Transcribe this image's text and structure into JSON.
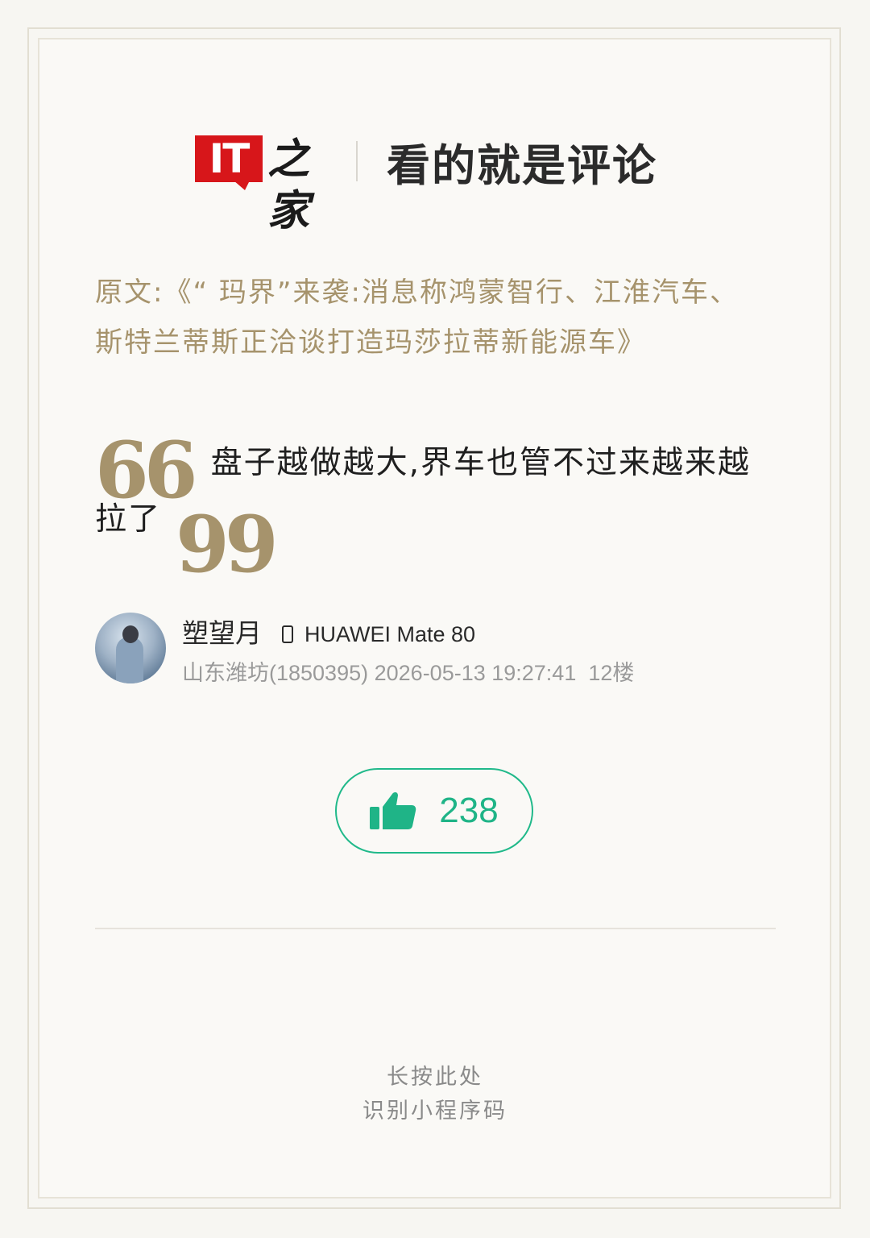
{
  "header": {
    "logo_text": "IT",
    "brand_text": "之家",
    "slogan": "看的就是评论"
  },
  "article": {
    "prefix": "原文:",
    "title": "《“ 玛界”来袭:消息称鸿蒙智行、江淮汽车、斯特兰蒂斯正洽谈打造玛莎拉蒂新能源车》"
  },
  "comment": {
    "open_quote": "66",
    "text": "盘子越做越大,界车也管不过来越来越拉了",
    "close_quote": "99"
  },
  "user": {
    "name": "塑望月",
    "device_icon": "phone-icon",
    "device": "HUAWEI Mate 80",
    "location": "山东潍坊(1850395)",
    "datetime": "2026-05-13 19:27:41",
    "floor": "12楼"
  },
  "like": {
    "icon": "thumbs-up-icon",
    "count": "238",
    "color": "#1fb487"
  },
  "footer": {
    "line1": "长按此处",
    "line2": "识别小程序码"
  },
  "colors": {
    "accent": "#a6936c",
    "brand_red": "#d7161a",
    "like_green": "#1fb487"
  }
}
